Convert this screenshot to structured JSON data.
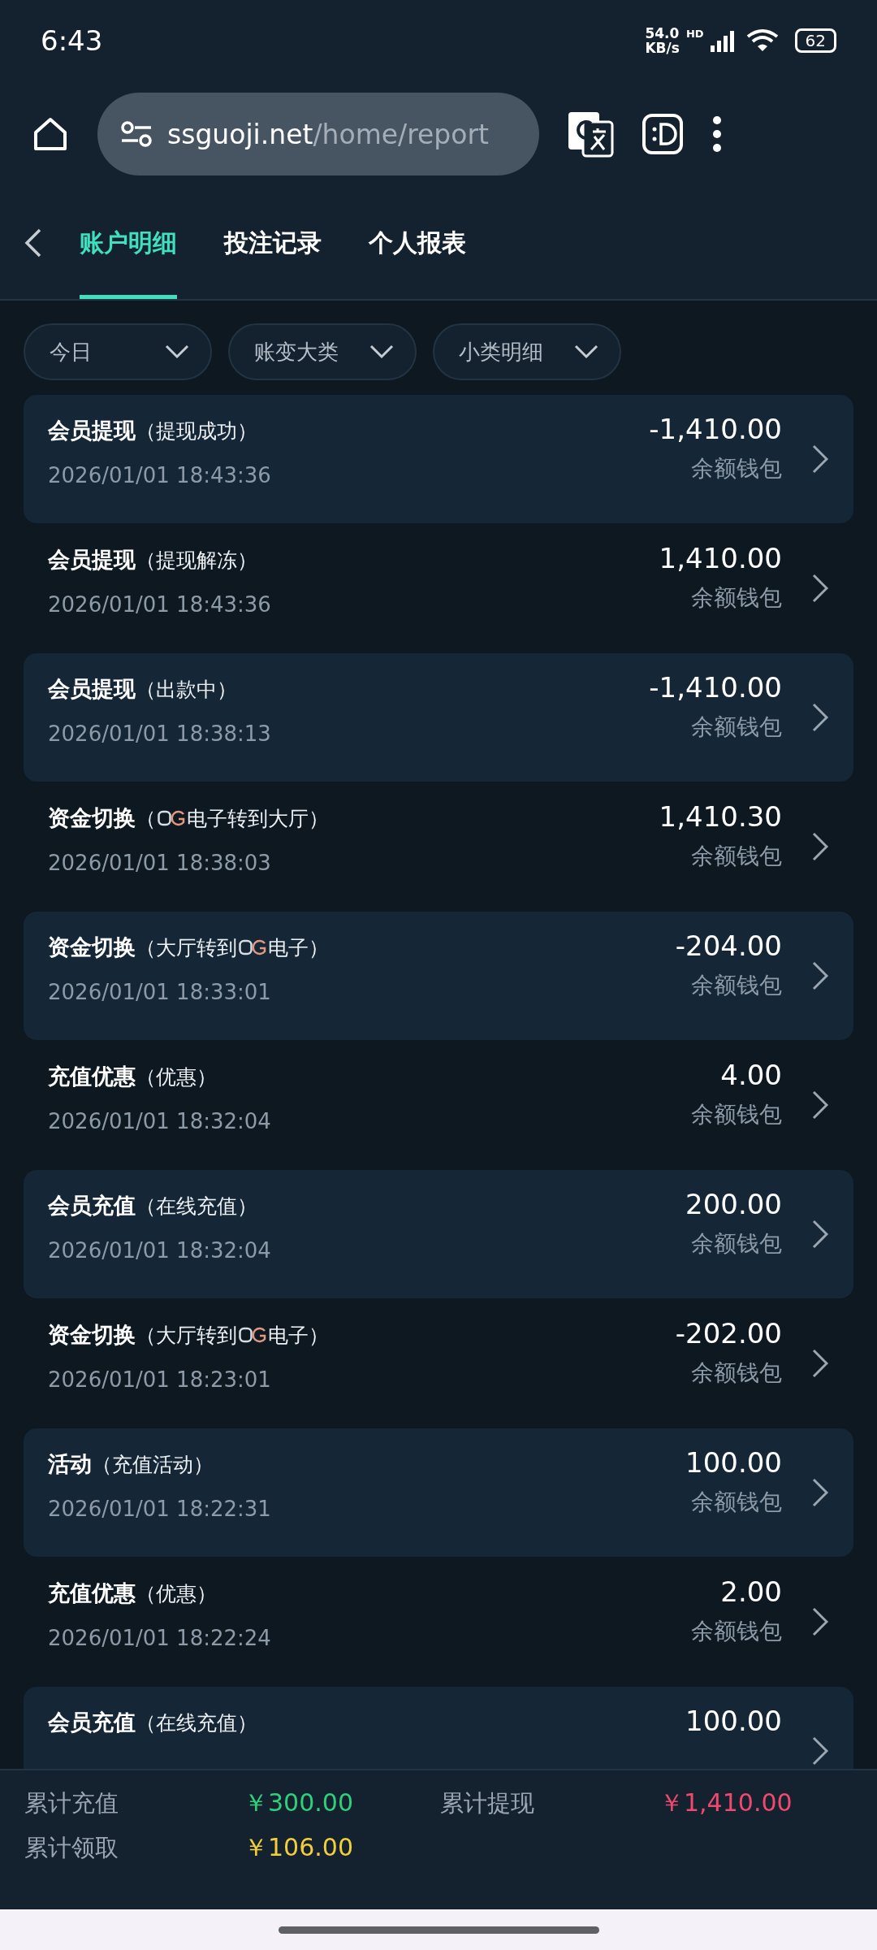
{
  "status_bar": {
    "time": "6:43",
    "speed_value": "54.0",
    "speed_unit": "KB/s",
    "network": "HD",
    "battery": "62"
  },
  "browser": {
    "url_host": "ssguoji.net",
    "url_path": "/home/report"
  },
  "tabs": [
    {
      "label": "账户明细",
      "selected": true
    },
    {
      "label": "投注记录",
      "selected": false
    },
    {
      "label": "个人报表",
      "selected": false
    }
  ],
  "filters": [
    "今日",
    "账变大类",
    "小类明细"
  ],
  "records": [
    {
      "title": "会员提现",
      "detail": [
        {
          "kind": "text",
          "text": "（提现成功）"
        }
      ],
      "time": "2026/01/01 18:43:36",
      "amount": "-1,410.00",
      "wallet": "余额钱包"
    },
    {
      "title": "会员提现",
      "detail": [
        {
          "kind": "text",
          "text": "（提现解冻）"
        }
      ],
      "time": "2026/01/01 18:43:36",
      "amount": "1,410.00",
      "wallet": "余额钱包"
    },
    {
      "title": "会员提现",
      "detail": [
        {
          "kind": "text",
          "text": "（出款中）"
        }
      ],
      "time": "2026/01/01 18:38:13",
      "amount": "-1,410.00",
      "wallet": "余额钱包"
    },
    {
      "title": "资金切换",
      "detail": [
        {
          "kind": "text",
          "text": "（"
        },
        {
          "kind": "logo"
        },
        {
          "kind": "text",
          "text": "电子转到大厅）"
        }
      ],
      "time": "2026/01/01 18:38:03",
      "amount": "1,410.30",
      "wallet": "余额钱包"
    },
    {
      "title": "资金切换",
      "detail": [
        {
          "kind": "text",
          "text": "（大厅转到"
        },
        {
          "kind": "logo"
        },
        {
          "kind": "text",
          "text": "电子）"
        }
      ],
      "time": "2026/01/01 18:33:01",
      "amount": "-204.00",
      "wallet": "余额钱包"
    },
    {
      "title": "充值优惠",
      "detail": [
        {
          "kind": "text",
          "text": "（优惠）"
        }
      ],
      "time": "2026/01/01 18:32:04",
      "amount": "4.00",
      "wallet": "余额钱包"
    },
    {
      "title": "会员充值",
      "detail": [
        {
          "kind": "text",
          "text": "（在线充值）"
        }
      ],
      "time": "2026/01/01 18:32:04",
      "amount": "200.00",
      "wallet": "余额钱包"
    },
    {
      "title": "资金切换",
      "detail": [
        {
          "kind": "text",
          "text": "（大厅转到"
        },
        {
          "kind": "logo"
        },
        {
          "kind": "text",
          "text": "电子）"
        }
      ],
      "time": "2026/01/01 18:23:01",
      "amount": "-202.00",
      "wallet": "余额钱包"
    },
    {
      "title": "活动",
      "detail": [
        {
          "kind": "text",
          "text": "（充值活动）"
        }
      ],
      "time": "2026/01/01 18:22:31",
      "amount": "100.00",
      "wallet": "余额钱包"
    },
    {
      "title": "充值优惠",
      "detail": [
        {
          "kind": "text",
          "text": "（优惠）"
        }
      ],
      "time": "2026/01/01 18:22:24",
      "amount": "2.00",
      "wallet": "余额钱包"
    },
    {
      "title": "会员充值",
      "detail": [
        {
          "kind": "text",
          "text": "（在线充值）"
        }
      ],
      "amount": "100.00"
    }
  ],
  "summary": [
    {
      "label": "累计充值",
      "value": "￥300.00",
      "color": "#2fd07a"
    },
    {
      "label": "累计提现",
      "value": "￥1,410.00",
      "color": "#f0486e"
    },
    {
      "label": "累计领取",
      "value": "￥106.00",
      "color": "#f2cf3a"
    }
  ]
}
